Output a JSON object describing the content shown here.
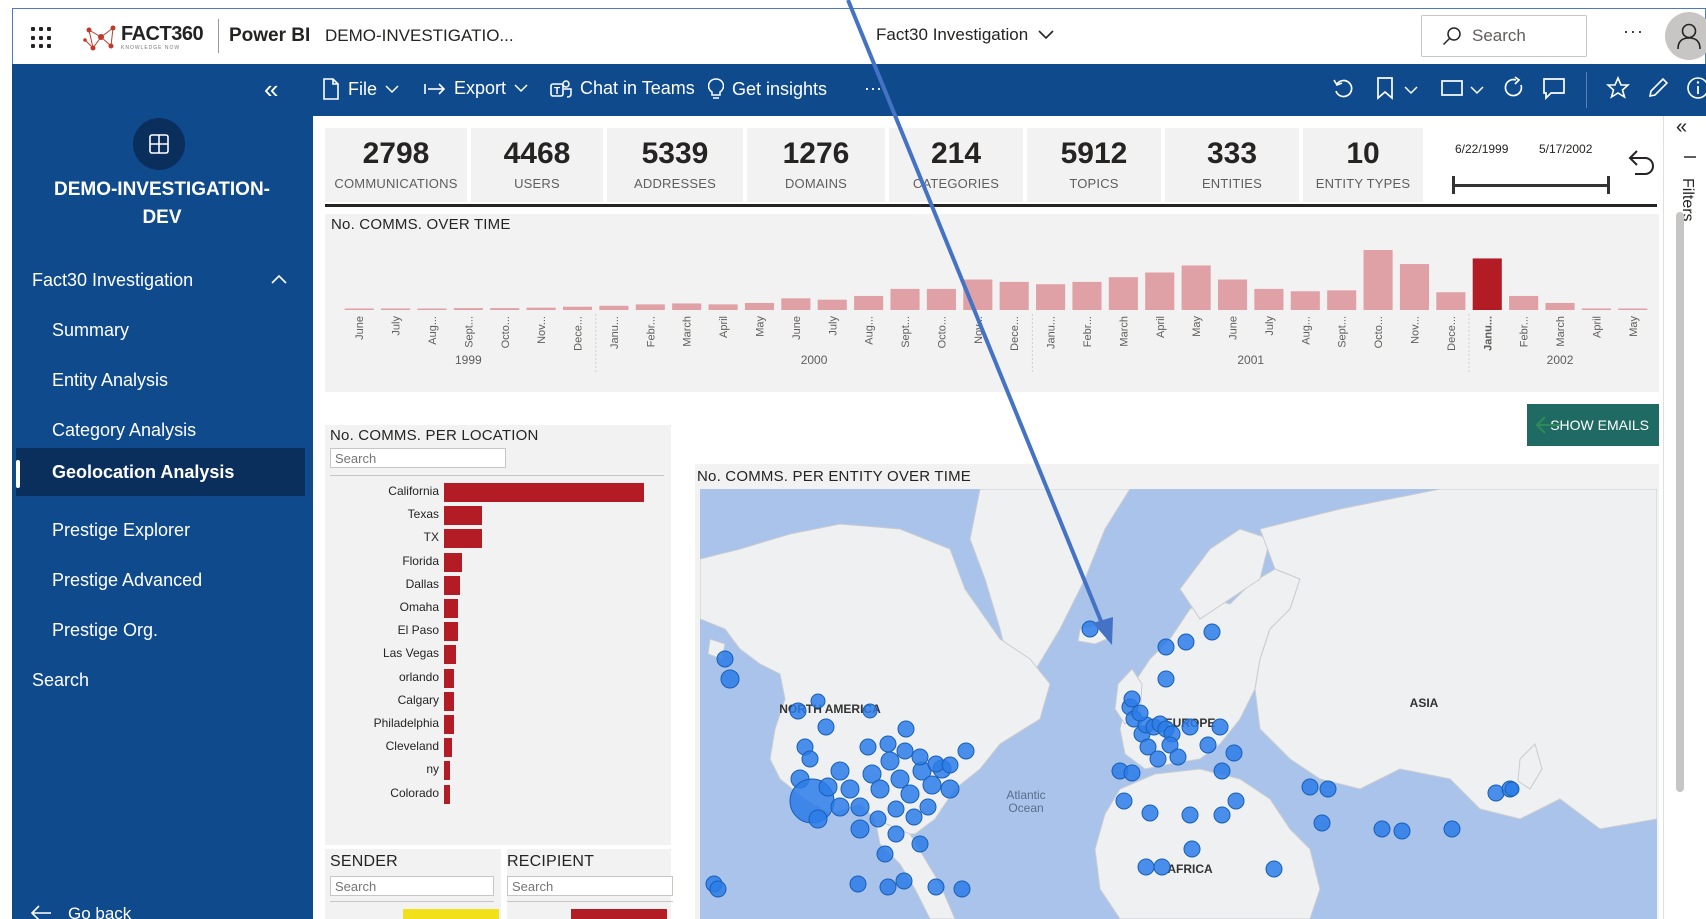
{
  "topbar": {
    "logo_text": "FACT360",
    "logo_sub": "KNOWLEDGE NOW",
    "product": "Power BI",
    "workspace": "DEMO-INVESTIGATIO...",
    "report_title": "Fact30 Investigation",
    "search_placeholder": "Search",
    "more": "···"
  },
  "actionbar": {
    "file": "File",
    "export": "Export",
    "chat": "Chat in Teams",
    "insights": "Get insights",
    "more": "···"
  },
  "leftnav": {
    "workspace_line1": "DEMO-INVESTIGATION-",
    "workspace_line2": "DEV",
    "report": "Fact30 Investigation",
    "pages": [
      "Summary",
      "Entity Analysis",
      "Category Analysis",
      "Geolocation Analysis",
      "Prestige Explorer",
      "Prestige Advanced",
      "Prestige Org."
    ],
    "active_page": "Geolocation Analysis",
    "search": "Search",
    "go_back": "Go back"
  },
  "kpis": [
    {
      "value": "2798",
      "label": "COMMUNICATIONS"
    },
    {
      "value": "4468",
      "label": "USERS"
    },
    {
      "value": "5339",
      "label": "ADDRESSES"
    },
    {
      "value": "1276",
      "label": "DOMAINS"
    },
    {
      "value": "214",
      "label": "CATEGORIES"
    },
    {
      "value": "5912",
      "label": "TOPICS"
    },
    {
      "value": "333",
      "label": "ENTITIES"
    },
    {
      "value": "10",
      "label": "ENTITY TYPES"
    }
  ],
  "date_slicer": {
    "start": "6/22/1999",
    "end": "5/17/2002"
  },
  "timeline": {
    "title": "No. COMMS. OVER TIME",
    "years": [
      "1999",
      "2000",
      "2001",
      "2002"
    ]
  },
  "show_emails": "SHOW EMAILS",
  "location": {
    "title": "No. COMMS. PER LOCATION",
    "search_placeholder": "Search"
  },
  "sender": {
    "title": "SENDER",
    "search_placeholder": "Search"
  },
  "recipient": {
    "title": "RECIPIENT",
    "search_placeholder": "Search"
  },
  "map": {
    "title": "No. COMMS. PER ENTITY OVER TIME",
    "labels": [
      "NORTH AMERICA",
      "EUROPE",
      "ASIA",
      "AFRICA",
      "Atlantic",
      "Ocean"
    ],
    "bubble_color": "#2b7de9"
  },
  "filters_label": "Filters",
  "chart_data": [
    {
      "type": "bar",
      "title": "No. COMMS. OVER TIME",
      "categories": [
        "June",
        "July",
        "Aug...",
        "Sept...",
        "Octo...",
        "Nov...",
        "Dece...",
        "Janu...",
        "Febr...",
        "March",
        "April",
        "May",
        "June",
        "July",
        "Aug...",
        "Sept...",
        "Octo...",
        "Nov...",
        "Dece...",
        "Janu...",
        "Febr...",
        "March",
        "April",
        "May",
        "June",
        "July",
        "Aug...",
        "Sept...",
        "Octo...",
        "Nov...",
        "Dece...",
        "Janu...",
        "Febr...",
        "March",
        "April",
        "May"
      ],
      "values": [
        2,
        2,
        3,
        4,
        4,
        5,
        7,
        9,
        12,
        14,
        12,
        15,
        25,
        22,
        30,
        45,
        45,
        65,
        60,
        55,
        60,
        70,
        80,
        95,
        65,
        45,
        40,
        42,
        128,
        98,
        38,
        110,
        30,
        15,
        3,
        3
      ],
      "highlight_index": 31,
      "years": [
        "1999",
        "2000",
        "2001",
        "2002"
      ],
      "colors": {
        "bar": "#e0a1a6",
        "highlight": "#b31c25"
      }
    },
    {
      "type": "bar",
      "title": "No. COMMS. PER LOCATION",
      "orientation": "horizontal",
      "categories": [
        "California",
        "Texas",
        "TX",
        "Florida",
        "Dallas",
        "Omaha",
        "El Paso",
        "Las Vegas",
        "orlando",
        "Calgary",
        "Philadelphia",
        "Cleveland",
        "ny",
        "Colorado"
      ],
      "values": [
        100,
        19,
        19,
        9,
        8,
        7,
        7,
        6,
        5,
        5,
        5,
        4,
        3,
        3
      ],
      "colors": {
        "bar": "#b31c25"
      }
    }
  ]
}
